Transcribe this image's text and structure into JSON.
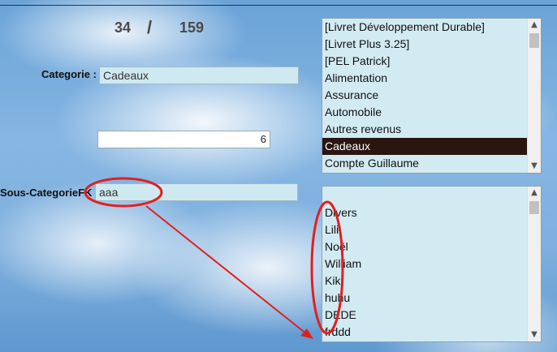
{
  "record": {
    "current": "34",
    "separator": "/",
    "total": "159"
  },
  "categorie": {
    "label": "Categorie :",
    "value": "Cadeaux"
  },
  "number_field": {
    "value": "6"
  },
  "sous_categorie": {
    "label": "Sous-CategorieFK",
    "value": "aaa"
  },
  "category_list": {
    "items": [
      "[Livret Développement Durable]",
      "[Livret Plus 3.25]",
      "[PEL Patrick]",
      "Alimentation",
      "Assurance",
      "Automobile",
      "Autres revenus",
      "Cadeaux",
      "Compte Guillaume"
    ],
    "selected": "Cadeaux"
  },
  "subcategory_list": {
    "items": [
      "Divers",
      "Lili",
      "Noël",
      "William",
      "Kiki",
      "huhu",
      "DEDE",
      "frddd"
    ]
  },
  "annotation": {
    "color": "#e02020"
  }
}
